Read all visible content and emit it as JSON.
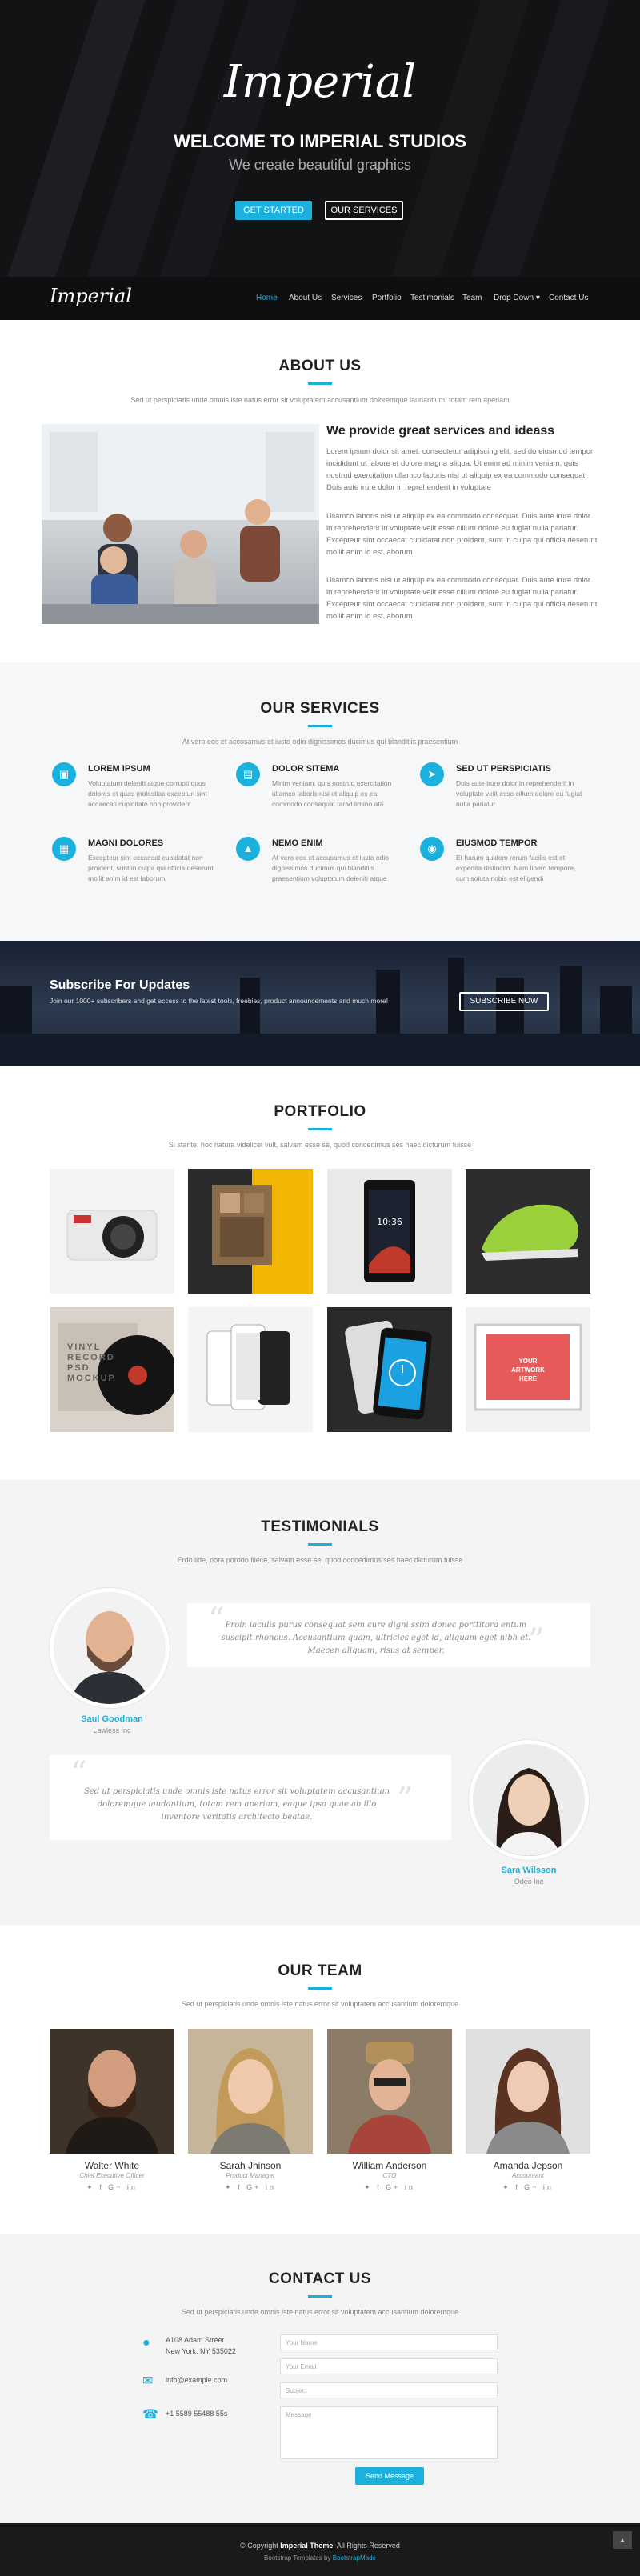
{
  "hero": {
    "brand": "Imperial",
    "welcome": "WELCOME TO IMPERIAL STUDIOS",
    "tagline": "We create beautiful graphics",
    "btn_primary": "GET STARTED",
    "btn_secondary": "OUR SERVICES"
  },
  "nav": {
    "logo": "Imperial",
    "items": [
      "Home",
      "About Us",
      "Services",
      "Portfolio",
      "Testimonials",
      "Team",
      "Drop Down",
      "Contact Us"
    ],
    "active_index": 0
  },
  "about": {
    "title": "ABOUT US",
    "subtitle": "Sed ut perspiciatis unde omnis iste natus error sit voluptatem accusantium doloremque laudantium, totam rem aperiam",
    "heading": "We provide great services and ideass",
    "p1": "Lorem ipsum dolor sit amet, consectetur adipiscing elit, sed do eiusmod tempor incididunt ut labore et dolore magna aliqua. Ut enim ad minim veniam, quis nostrud exercitation ullamco laboris nisi ut aliquip ex ea commodo consequat. Duis aute irure dolor in reprehenderit in voluptate",
    "p2": "Ullamco laboris nisi ut aliquip ex ea commodo consequat. Duis aute irure dolor in reprehenderit in voluptate velit esse cillum dolore eu fugiat nulla pariatur. Excepteur sint occaecat cupidatat non proident, sunt in culpa qui officia deserunt mollit anim id est laborum",
    "p3": "Ullamco laboris nisi ut aliquip ex ea commodo consequat. Duis aute irure dolor in reprehenderit in voluptate velit esse cillum dolore eu fugiat nulla pariatur. Excepteur sint occaecat cupidatat non proident, sunt in culpa qui officia deserunt mollit anim id est laborum"
  },
  "services": {
    "title": "OUR SERVICES",
    "subtitle": "At vero eos et accusamus et iusto odio dignissimos ducimus qui blanditiis praesentium",
    "items": [
      {
        "title": "LOREM IPSUM",
        "icon": "display-icon",
        "text": "Voluptatum deleniti atque corrupti quos dolores et quas molestias excepturi sint occaecati cupiditate non provident"
      },
      {
        "title": "DOLOR SITEMA",
        "icon": "chart-icon",
        "text": "Minim veniam, quis nostrud exercitation ullamco laboris nisi ut aliquip ex ea commodo consequat tarad limino ata"
      },
      {
        "title": "SED UT PERSPICIATIS",
        "icon": "paper-plane-icon",
        "text": "Duis aute irure dolor in reprehenderit in voluptate velit esse cillum dolore eu fugiat nulla pariatur"
      },
      {
        "title": "MAGNI DOLORES",
        "icon": "image-icon",
        "text": "Excepteur sint occaecat cupidatat non proident, sunt in culpa qui officia deserunt mollit anim id est laborum"
      },
      {
        "title": "NEMO ENIM",
        "icon": "road-icon",
        "text": "At vero eos et accusamus et iusto odio dignissimos ducimus qui blanditiis praesentium voluptatum deleniti atque"
      },
      {
        "title": "EIUSMOD TEMPOR",
        "icon": "shopping-bag-icon",
        "text": "Et harum quidem rerum facilis est et expedita distinctio. Nam libero tempore, cum soluta nobis est eligendi"
      }
    ]
  },
  "subscribe": {
    "title": "Subscribe For Updates",
    "text": "Join our 1000+ subscribers and get access to the latest tools, freebies, product announcements and much more!",
    "button": "SUBSCRIBE NOW"
  },
  "portfolio": {
    "title": "PORTFOLIO",
    "subtitle": "Si stante, hoc natura videlicet vult, salvam esse se, quod concedimus ses haec dicturum fuisse",
    "tiles": [
      "camera",
      "magazine",
      "phone",
      "sneaker",
      "record",
      "iphones",
      "watch-app",
      "poster"
    ],
    "record_text": "VINYL RECORD PSD MOCKUP",
    "poster_text": "YOUR ARTWORK HERE"
  },
  "testimonials": {
    "title": "TESTIMONIALS",
    "subtitle": "Erdo lide, nora porodo filece, salvam esse se, quod concedimus ses haec dicturum fuisse",
    "items": [
      {
        "name": "Saul Goodman",
        "role": "Lawless Inc",
        "quote": "Proin iaculis purus consequat sem cure digni ssim donec porttitora entum suscipit rhoncus. Accusantium quam, ultricies eget id, aliquam eget nibh et. Maecen aliquam, risus at semper."
      },
      {
        "name": "Sara Wilsson",
        "role": "Odeo Inc",
        "quote": "Sed ut perspiciatis unde omnis iste natus error sit voluptatem accusantium doloremque laudantium, totam rem aperiam, eaque ipsa quae ab illo inventore veritatis architecto beatae."
      }
    ]
  },
  "team": {
    "title": "OUR TEAM",
    "subtitle": "Sed ut perspiciatis unde omnis iste natus error sit voluptatem accusantium doloremque",
    "members": [
      {
        "name": "Walter White",
        "role": "Chief Executive Officer"
      },
      {
        "name": "Sarah Jhinson",
        "role": "Product Manager"
      },
      {
        "name": "William Anderson",
        "role": "CTO"
      },
      {
        "name": "Amanda Jepson",
        "role": "Accountant"
      }
    ],
    "social": "✦ f G+ in"
  },
  "contact": {
    "title": "CONTACT US",
    "subtitle": "Sed ut perspiciatis unde omnis iste natus error sit voluptatem accusantium doloremque",
    "address1": "A108 Adam Street",
    "address2": "New York, NY 535022",
    "email": "info@example.com",
    "phone": "+1 5589 55488 55s",
    "fields": {
      "name": "Your Name",
      "email": "Your Email",
      "subject": "Subject",
      "message": "Message"
    },
    "send": "Send Message"
  },
  "footer": {
    "copy_prefix": "© Copyright",
    "copy_brand": "Imperial Theme",
    "copy_suffix": ". All Rights Reserved",
    "credit_prefix": "Bootstrap Templates by",
    "credit_link": "BootstrapMade",
    "back_to_top": "▲"
  },
  "colors": {
    "accent": "#1bb1dc",
    "dark": "#121315"
  }
}
